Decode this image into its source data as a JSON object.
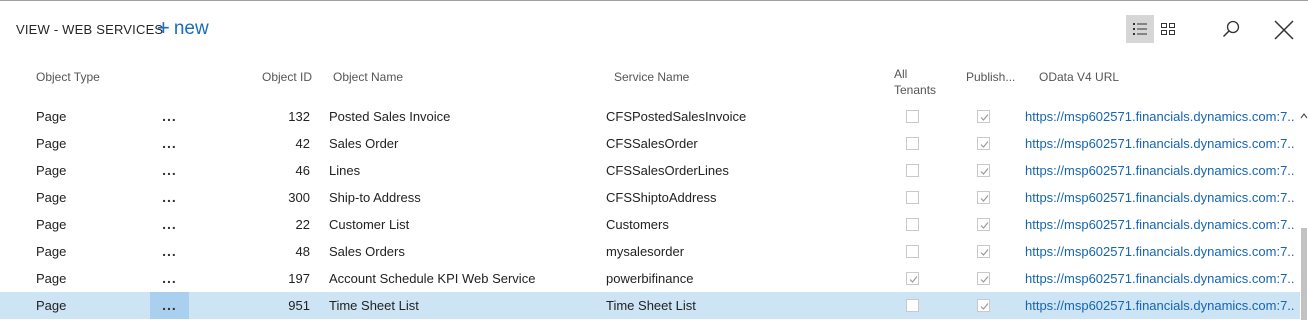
{
  "header": {
    "title": "VIEW - WEB SERVICES",
    "new_label": "new"
  },
  "toolbar": {
    "icons": [
      "list-view-icon",
      "tile-view-icon",
      "search-icon",
      "close-icon"
    ],
    "active_view": "list"
  },
  "columns": {
    "object_type": "Object Type",
    "object_id": "Object ID",
    "object_name": "Object Name",
    "service_name": "Service Name",
    "all_tenants": [
      "All",
      "Tenants"
    ],
    "published": "Publish...",
    "odata_url": "OData V4 URL"
  },
  "row_actions_label": "...",
  "rows": [
    {
      "type": "Page",
      "id": "132",
      "name": "Posted Sales Invoice",
      "service": "CFSPostedSalesInvoice",
      "all_tenants": false,
      "published": true,
      "url": "https://msp602571.financials.dynamics.com:7...",
      "selected": false
    },
    {
      "type": "Page",
      "id": "42",
      "name": "Sales Order",
      "service": "CFSSalesOrder",
      "all_tenants": false,
      "published": true,
      "url": "https://msp602571.financials.dynamics.com:7...",
      "selected": false
    },
    {
      "type": "Page",
      "id": "46",
      "name": "Lines",
      "service": "CFSSalesOrderLines",
      "all_tenants": false,
      "published": true,
      "url": "https://msp602571.financials.dynamics.com:7...",
      "selected": false
    },
    {
      "type": "Page",
      "id": "300",
      "name": "Ship-to Address",
      "service": "CFSShiptoAddress",
      "all_tenants": false,
      "published": true,
      "url": "https://msp602571.financials.dynamics.com:7...",
      "selected": false
    },
    {
      "type": "Page",
      "id": "22",
      "name": "Customer List",
      "service": "Customers",
      "all_tenants": false,
      "published": true,
      "url": "https://msp602571.financials.dynamics.com:7...",
      "selected": false
    },
    {
      "type": "Page",
      "id": "48",
      "name": "Sales Orders",
      "service": "mysalesorder",
      "all_tenants": false,
      "published": true,
      "url": "https://msp602571.financials.dynamics.com:7...",
      "selected": false
    },
    {
      "type": "Page",
      "id": "197",
      "name": "Account Schedule KPI Web Service",
      "service": "powerbifinance",
      "all_tenants": true,
      "published": true,
      "url": "https://msp602571.financials.dynamics.com:7...",
      "selected": false
    },
    {
      "type": "Page",
      "id": "951",
      "name": "Time Sheet List",
      "service": "Time Sheet List",
      "all_tenants": false,
      "published": true,
      "url": "https://msp602571.financials.dynamics.com:7...",
      "selected": true
    }
  ],
  "colors": {
    "accent": "#1a6cbf",
    "link": "#1565b2",
    "selected_row": "#cde4f5",
    "selected_actions": "#a9d0ee"
  }
}
